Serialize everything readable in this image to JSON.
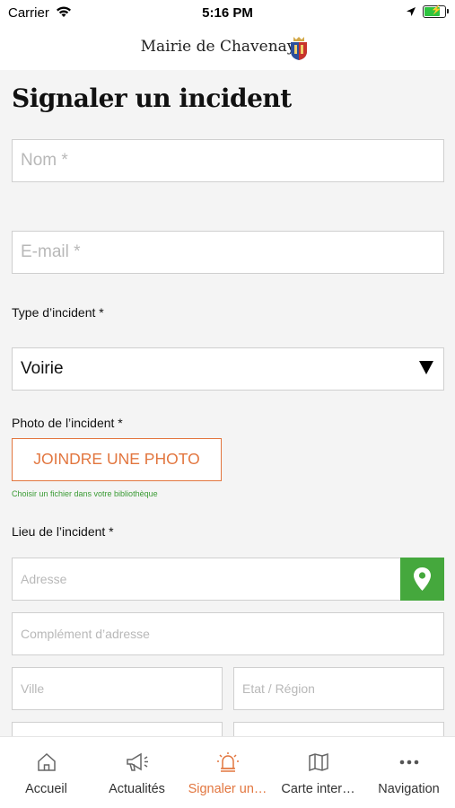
{
  "status_bar": {
    "carrier": "Carrier",
    "time": "5:16 PM",
    "battery_color": "#2ec43f"
  },
  "header": {
    "title": "Mairie de Chavenay"
  },
  "page": {
    "title": "Signaler un incident"
  },
  "form": {
    "name_placeholder": "Nom *",
    "email_placeholder": "E-mail *",
    "type_label": "Type d’incident *",
    "type_value": "Voirie",
    "photo_label": "Photo de l’incident *",
    "photo_button": "JOINDRE UNE PHOTO",
    "photo_hint": "Choisir un fichier dans votre bibliothèque",
    "location_label": "Lieu de l’incident *",
    "address_placeholder": "Adresse",
    "address_complement_placeholder": "Complément d’adresse",
    "city_placeholder": "Ville",
    "region_placeholder": "Etat / Région"
  },
  "tabbar": {
    "active_color": "#e2763f",
    "items": [
      {
        "label": "Accueil",
        "icon": "home-icon"
      },
      {
        "label": "Actualités",
        "icon": "megaphone-icon"
      },
      {
        "label": "Signaler un…",
        "icon": "alarm-icon"
      },
      {
        "label": "Carte inter…",
        "icon": "map-icon"
      },
      {
        "label": "Navigation",
        "icon": "more-dots-icon"
      }
    ]
  }
}
